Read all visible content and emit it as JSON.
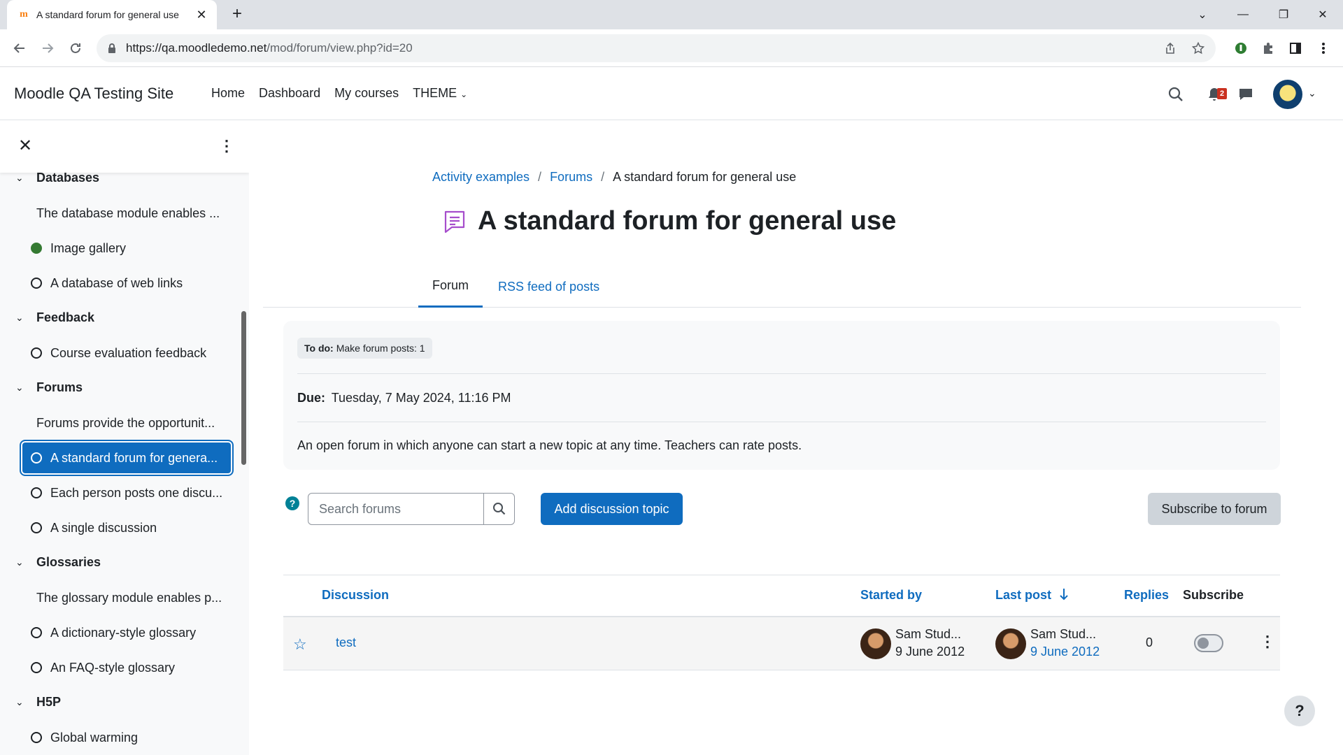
{
  "browser": {
    "tab_title": "A standard forum for general use",
    "url_host": "https://qa.moodledemo.net",
    "url_path": "/mod/forum/view.php?id=20"
  },
  "navbar": {
    "site_name": "Moodle QA Testing Site",
    "links": [
      "Home",
      "Dashboard",
      "My courses",
      "THEME"
    ],
    "notification_count": "2"
  },
  "drawer": {
    "entries": [
      {
        "type": "section",
        "label": "Databases"
      },
      {
        "type": "desc",
        "label": "The database module enables ..."
      },
      {
        "type": "item",
        "label": "Image gallery",
        "done": true
      },
      {
        "type": "item",
        "label": "A database of web links"
      },
      {
        "type": "section",
        "label": "Feedback"
      },
      {
        "type": "item",
        "label": "Course evaluation feedback"
      },
      {
        "type": "section",
        "label": "Forums"
      },
      {
        "type": "desc",
        "label": "Forums provide the opportunit..."
      },
      {
        "type": "item",
        "label": "A standard forum for genera...",
        "active": true
      },
      {
        "type": "item",
        "label": "Each person posts one discu..."
      },
      {
        "type": "item",
        "label": "A single discussion"
      },
      {
        "type": "section",
        "label": "Glossaries"
      },
      {
        "type": "desc",
        "label": "The glossary module enables p..."
      },
      {
        "type": "item",
        "label": "A dictionary-style glossary"
      },
      {
        "type": "item",
        "label": "An FAQ-style glossary"
      },
      {
        "type": "section",
        "label": "H5P"
      },
      {
        "type": "item",
        "label": "Global warming"
      }
    ]
  },
  "breadcrumb": {
    "items": [
      "Activity examples",
      "Forums"
    ],
    "separator": "/",
    "current": "A standard forum for general use"
  },
  "page": {
    "title": "A standard forum for general use",
    "tabs": [
      "Forum",
      "RSS feed of posts"
    ]
  },
  "activity_info": {
    "todo_label": "To do:",
    "todo_value": "Make forum posts: 1",
    "due_label": "Due:",
    "due_value": "Tuesday, 7 May 2024, 11:16 PM",
    "intro": "An open forum in which anyone can start a new topic at any time. Teachers can rate posts."
  },
  "actions": {
    "search_placeholder": "Search forums",
    "add_discussion": "Add discussion topic",
    "subscribe_forum": "Subscribe to forum"
  },
  "table": {
    "headers": {
      "discussion": "Discussion",
      "started_by": "Started by",
      "last_post": "Last post",
      "replies": "Replies",
      "subscribe": "Subscribe"
    },
    "rows": [
      {
        "discussion": "test",
        "started_by_name": "Sam Stud...",
        "started_by_date": "9 June 2012",
        "last_post_name": "Sam Stud...",
        "last_post_date": "9 June 2012",
        "replies": "0",
        "subscribed": false
      }
    ]
  },
  "help_float": "?"
}
